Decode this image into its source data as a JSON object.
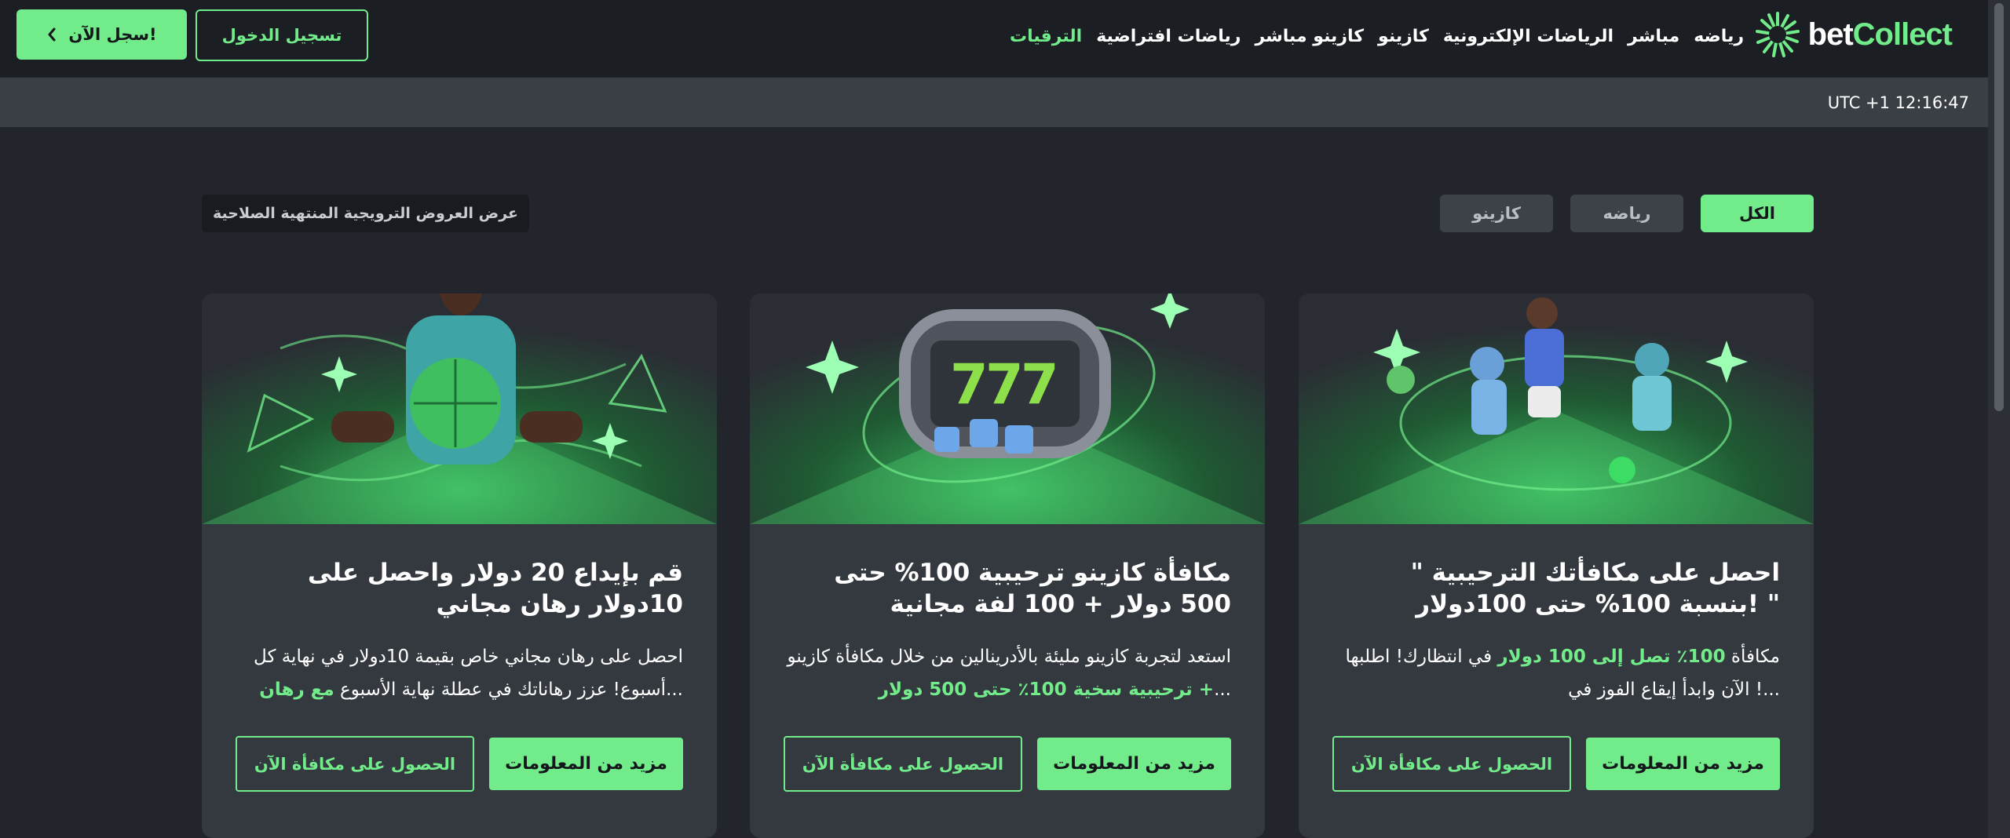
{
  "brand": {
    "name_part1": "bet",
    "name_part2": "Collect"
  },
  "nav": {
    "items": [
      "رياضه",
      "مباشر",
      "الرياضات الإلكترونية",
      "كازينو",
      "كازينو مباشر",
      "رياضات افتراضية",
      "الترقيات"
    ],
    "active_index": 6
  },
  "header": {
    "signup_label": "سجل الآن!",
    "login_label": "تسجيل الدخول"
  },
  "clock": "UTC +1 12:16:47",
  "filters": {
    "tabs": [
      "الكل",
      "رياضه",
      "كازينو"
    ],
    "active_index": 0,
    "expired_label": "عرض العروض الترويجية المنتهية الصلاحية"
  },
  "promotions": [
    {
      "title": "\" احصل على مكافأتك الترحيبية بنسبة 100% حتى 100دولار! \"",
      "desc_parts": [
        "مكافأة ",
        "100٪ تصل إلى 100 دولار",
        " في انتظارك! اطلبها الآن وابدأ إيقاع الفوز في !..."
      ],
      "more_label": "مزيد من المعلومات",
      "claim_label": "الحصول على مكافأة الآن"
    },
    {
      "title": "مكافأة كازينو ترحيبية 100% حتى 500 دولار + 100 لفة مجانية",
      "desc_parts": [
        "استعد لتجربة كازينو مليئة بالأدرينالين من خلال مكافأة كازينو ",
        "ترحيبية سخية 100٪ حتى 500 دولار +",
        "..."
      ],
      "more_label": "مزيد من المعلومات",
      "claim_label": "الحصول على مكافأة الآن"
    },
    {
      "title": "قم بإيداع 20 دولار واحصل على 10دولار رهان مجاني",
      "desc_parts": [
        "احصل على رهان مجاني خاص بقيمة 10دولار في نهاية كل أسبوع! عزز رهاناتك في عطلة نهاية الأسبوع ",
        "مع رهان",
        "..."
      ],
      "more_label": "مزيد من المعلومات",
      "claim_label": "الحصول على مكافأة الآن"
    }
  ],
  "colors": {
    "accent": "#72ec8a",
    "background": "#22252b",
    "topbar": "#1b1e23",
    "card": "#34383f"
  }
}
